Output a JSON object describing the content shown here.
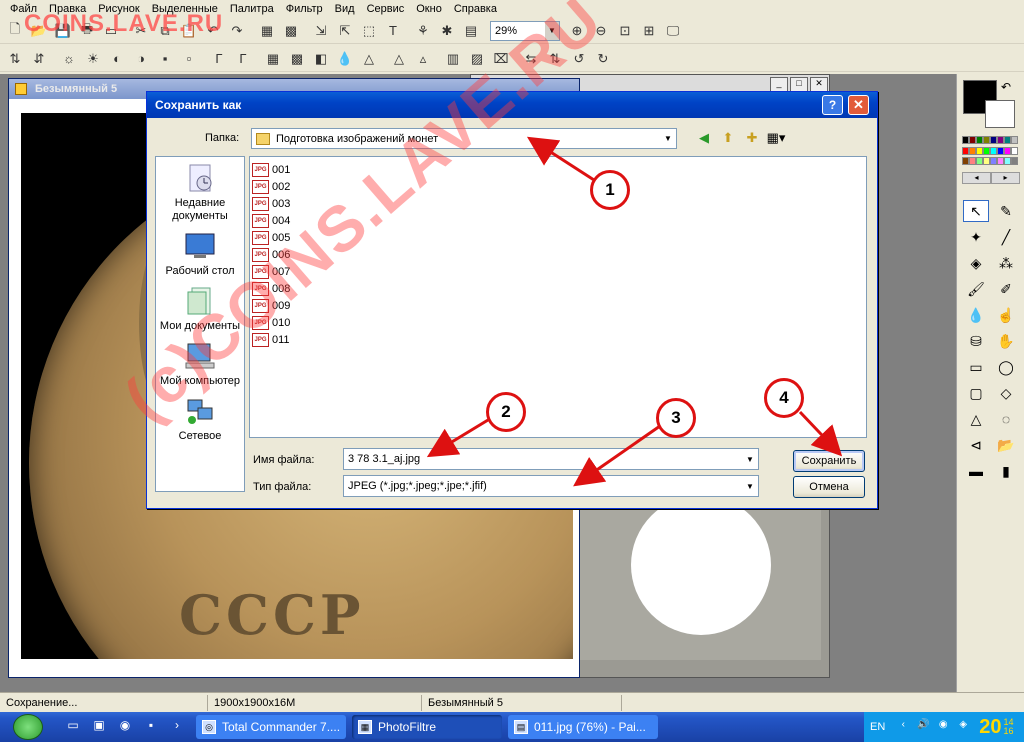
{
  "menu": [
    "Файл",
    "Правка",
    "Рисунок",
    "Выделенные",
    "Палитра",
    "Фильтр",
    "Вид",
    "Сервис",
    "Окно",
    "Справка"
  ],
  "watermark_top": "COINS.LAVE.RU",
  "watermark_diag": "(с)COINS.LAVE.RU",
  "toolbar": {
    "zoom": "29%"
  },
  "doc_window": {
    "title": "Безымянный 5",
    "coin_text": "СССР"
  },
  "dialog": {
    "title": "Сохранить как",
    "help_label": "?",
    "close_label": "✕",
    "folder_label": "Папка:",
    "folder_value": "Подготовка изображений монет",
    "places": [
      {
        "label": "Недавние документы",
        "icon": "recent-documents-icon"
      },
      {
        "label": "Рабочий стол",
        "icon": "desktop-icon"
      },
      {
        "label": "Мои документы",
        "icon": "my-documents-icon"
      },
      {
        "label": "Мой компьютер",
        "icon": "my-computer-icon"
      },
      {
        "label": "Сетевое",
        "icon": "network-icon"
      }
    ],
    "files": [
      "001",
      "002",
      "003",
      "004",
      "005",
      "006",
      "007",
      "008",
      "009",
      "010",
      "011"
    ],
    "file_badge": "JPG",
    "filename_label": "Имя файла:",
    "filename_value": "3 78 3.1_aj.jpg",
    "filetype_label": "Тип файла:",
    "filetype_value": "JPEG (*.jpg;*.jpeg;*.jpe;*.jfif)",
    "save_label": "Сохранить",
    "cancel_label": "Отмена"
  },
  "annotations": [
    "1",
    "2",
    "3",
    "4"
  ],
  "status": {
    "text": "Сохранение...",
    "size": "1900x1900x16M",
    "doc": "Безымянный 5"
  },
  "taskbar": {
    "tasks": [
      "Total Commander 7....",
      "PhotoFiltre",
      "011.jpg (76%) - Pai..."
    ],
    "lang": "EN",
    "clock": "20",
    "clock_small_top": "14",
    "clock_small_bottom": "16"
  },
  "colors": {
    "annotation": "#dd1111",
    "title_bar": "#0043c6",
    "watermark": "#ff4646"
  }
}
